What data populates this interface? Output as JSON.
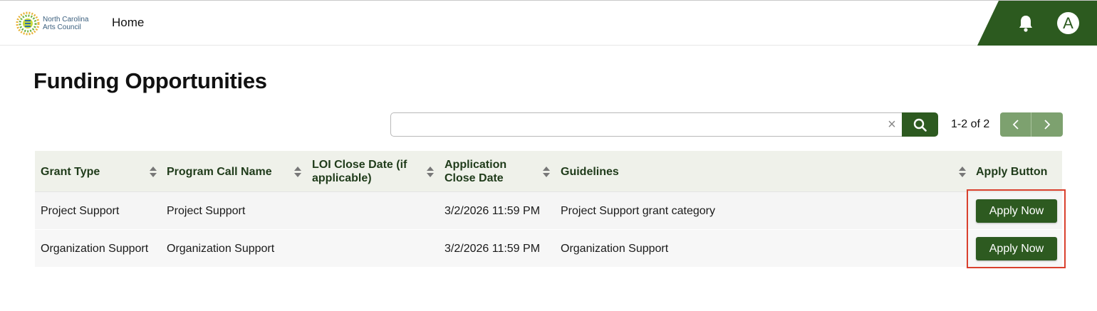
{
  "header": {
    "logo_line1": "North Carolina",
    "logo_line2": "Arts Council",
    "home_label": "Home",
    "bell_icon": "bell-icon",
    "avatar_letter": "A",
    "accent_color": "#2c5a1f"
  },
  "page": {
    "title": "Funding Opportunities"
  },
  "search": {
    "value": "",
    "placeholder": "",
    "clear_symbol": "×",
    "search_icon": "search-icon"
  },
  "pager": {
    "text": "1-2 of 2",
    "prev_icon": "chevron-left-icon",
    "next_icon": "chevron-right-icon"
  },
  "table": {
    "columns": [
      "Grant Type",
      "Program Call Name",
      "LOI Close Date (if applicable)",
      "Application Close Date",
      "Guidelines",
      "Apply Button"
    ],
    "rows": [
      {
        "grant_type": "Project Support",
        "program_call_name": "Project Support",
        "loi_close_date": "",
        "application_close_date": "3/2/2026 11:59 PM",
        "guidelines": "Project Support grant category",
        "apply_label": "Apply Now"
      },
      {
        "grant_type": "Organization Support",
        "program_call_name": "Organization Support",
        "loi_close_date": "",
        "application_close_date": "3/2/2026 11:59 PM",
        "guidelines": "Organization Support",
        "apply_label": "Apply Now"
      }
    ]
  },
  "colors": {
    "primary_green": "#2d5a20",
    "pager_green": "#7da16f",
    "header_row_bg": "#eff1ea",
    "highlight_red": "#d9402e"
  }
}
